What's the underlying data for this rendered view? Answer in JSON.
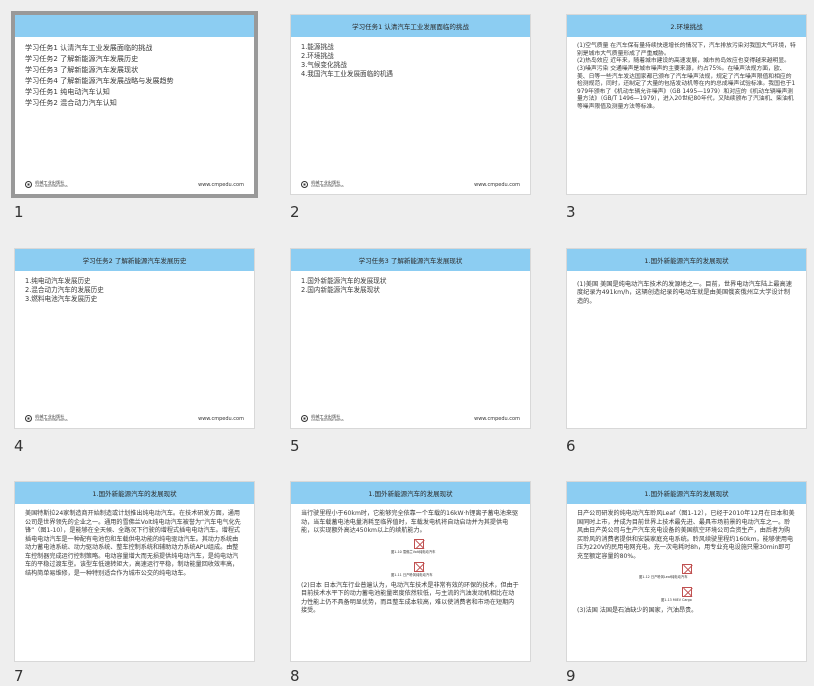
{
  "footer": {
    "publisher_cn": "机械工业出版社",
    "publisher_en": "CHINA MACHINE PRESS",
    "url": "www.cmpedu.com"
  },
  "slides": [
    {
      "number": "1",
      "title": "",
      "lines": [
        "学习任务1   认清汽车工业发展面临的挑战",
        "学习任务2   了解新能源汽车发展历史",
        "学习任务3   了解新能源汽车发展现状",
        "学习任务4   了解新能源汽车发展战略与发展趋势",
        "学习任务1   纯电动汽车认知",
        "学习任务2   混合动力汽车认知"
      ]
    },
    {
      "number": "2",
      "title": "学习任务1   认清汽车工业发展面临的挑战",
      "lines": [
        "1.能源挑战",
        "2.环境挑战",
        "3.气候变化挑战",
        "4.我国汽车工业发展面临的机遇"
      ]
    },
    {
      "number": "3",
      "title": "2.环境挑战",
      "paras": [
        "(1)空气质量   在汽车保有量持续快速增长的情况下，汽车排放污染对我国大气环境，特别是城市大气质量形成了严重威胁。",
        "(2)热岛效应   近年来，随着城市建设的高速发展，城市热岛效应也变得越来越明显。",
        "(3)噪声污染   交通噪声是城市噪声的主要来源，约占75%。在噪声法规方面，欧、美、日等一些汽车发达国家都已颁布了汽车噪声法规，规定了汽车噪声限值和相应的检测规范，同时，还制定了大量的包括发动机等在内的总成噪声试验标准。我国也于1979年颁布了《机动车辆允许噪声》（GB 1495—1979）和对应的《机动车辆噪声测量方法》（GB/T 1496—1979），进入20世纪80年代，又陆续颁布了汽油机、柴油机等噪声限值及测量方法等标准。"
      ]
    },
    {
      "number": "4",
      "title": "学习任务2   了解新能源汽车发展历史",
      "lines": [
        "1.纯电动汽车发展历史",
        "2.混合动力汽车的发展历史",
        "3.燃料电池汽车发展历史"
      ]
    },
    {
      "number": "5",
      "title": "学习任务3   了解新能源汽车发展现状",
      "lines": [
        "1.国外新能源汽车的发展现状",
        "2.国内新能源汽车发展现状"
      ]
    },
    {
      "number": "6",
      "title": "1.国外新能源汽车的发展现状",
      "paras": [
        "(1)美国   美国是纯电动汽车技术的发源地之一。目前，世界电动汽车陆上最高速度纪录为491km/h，这辆创造纪录的电动车就是由美国俄亥俄州立大学设计制造的。"
      ]
    },
    {
      "number": "7",
      "title": "1.国外新能源汽车的发展现状",
      "paras": [
        "美国特斯拉24家制造商开始制造或计划推出纯电动汽车。在技术研发方面，通用公司是世界领先的企业之一。通用的雪佛兰Volt纯电动汽车被誉为“汽车电气化先锋”（图1-10），是能够在全天候、全路况下行驶的增程式插电电动汽车。增程式插电电动汽车是一种配有电池包和车载供电功能的纯电驱动汽车。其动力系统由动力蓄电池系统、动力驱动系统、整车控制系统和辅助动力系统APU组成。由整车控制器完成运行控制策略。电动容量增大而无损提供纯电动汽车，是纯电动汽车的平稳过渡车型。该型车低速转矩大，高速运行平稳，制动能量回收效率高，结构简单易维修，是一种特别适合作为城市公交的纯电动车。"
      ]
    },
    {
      "number": "8",
      "title": "1.国外新能源汽车的发展现状",
      "paras_top": [
        "当行驶里程小于60km时，它能够完全依靠一个车载的16kW·h锂离子蓄电池来驱动，当车载蓄电池电量消耗至临界值时，车载发电机将自动启动并为其提供电能，以实现额外高达450km以上的续航能力。"
      ],
      "fig_captions": [
        "图1-10   雪佛兰Volt纯电动汽车",
        "图1-11   日产聆风纯电动汽车"
      ],
      "paras_bottom": [
        "(2)日本   日本汽车行业普遍认为，电动汽车技术是非常有效的环保的技术，但由于目前技术水平下的动力蓄电池能量密度依然较低，与主流的汽油发动机相比在动力性能上仍不具备明显优势，而且整车成本较高，难以使消费者和市场在短期内接受。"
      ]
    },
    {
      "number": "9",
      "title": "1.国外新能源汽车的发展现状",
      "paras_top": [
        "日产公司研发的纯电动汽车聆风Leaf（图1-12），已经于2010年12月在日本和美国同时上市，并成为目前世界上技术最先进、最具市场前景的电动汽车之一。聆风由日产英公司与生产汽车充电设备的美国航空环境公司合资生产，由后者为购买聆风的消费者提供和安装家庭充电系统。聆风续驶里程约160km，能够使用电压为220V的民用电网充电，充一次电耗时8h，用专业充电设施只需30min即可充至额定容量的80%。"
      ],
      "fig_captions": [
        "图1-12   日产聆风Leaf纯电动汽车",
        "图1-13   MIEV Cargo"
      ],
      "paras_bottom": [
        "(3)法国   法国是石油缺少的国家，汽油昂贵。"
      ]
    }
  ]
}
